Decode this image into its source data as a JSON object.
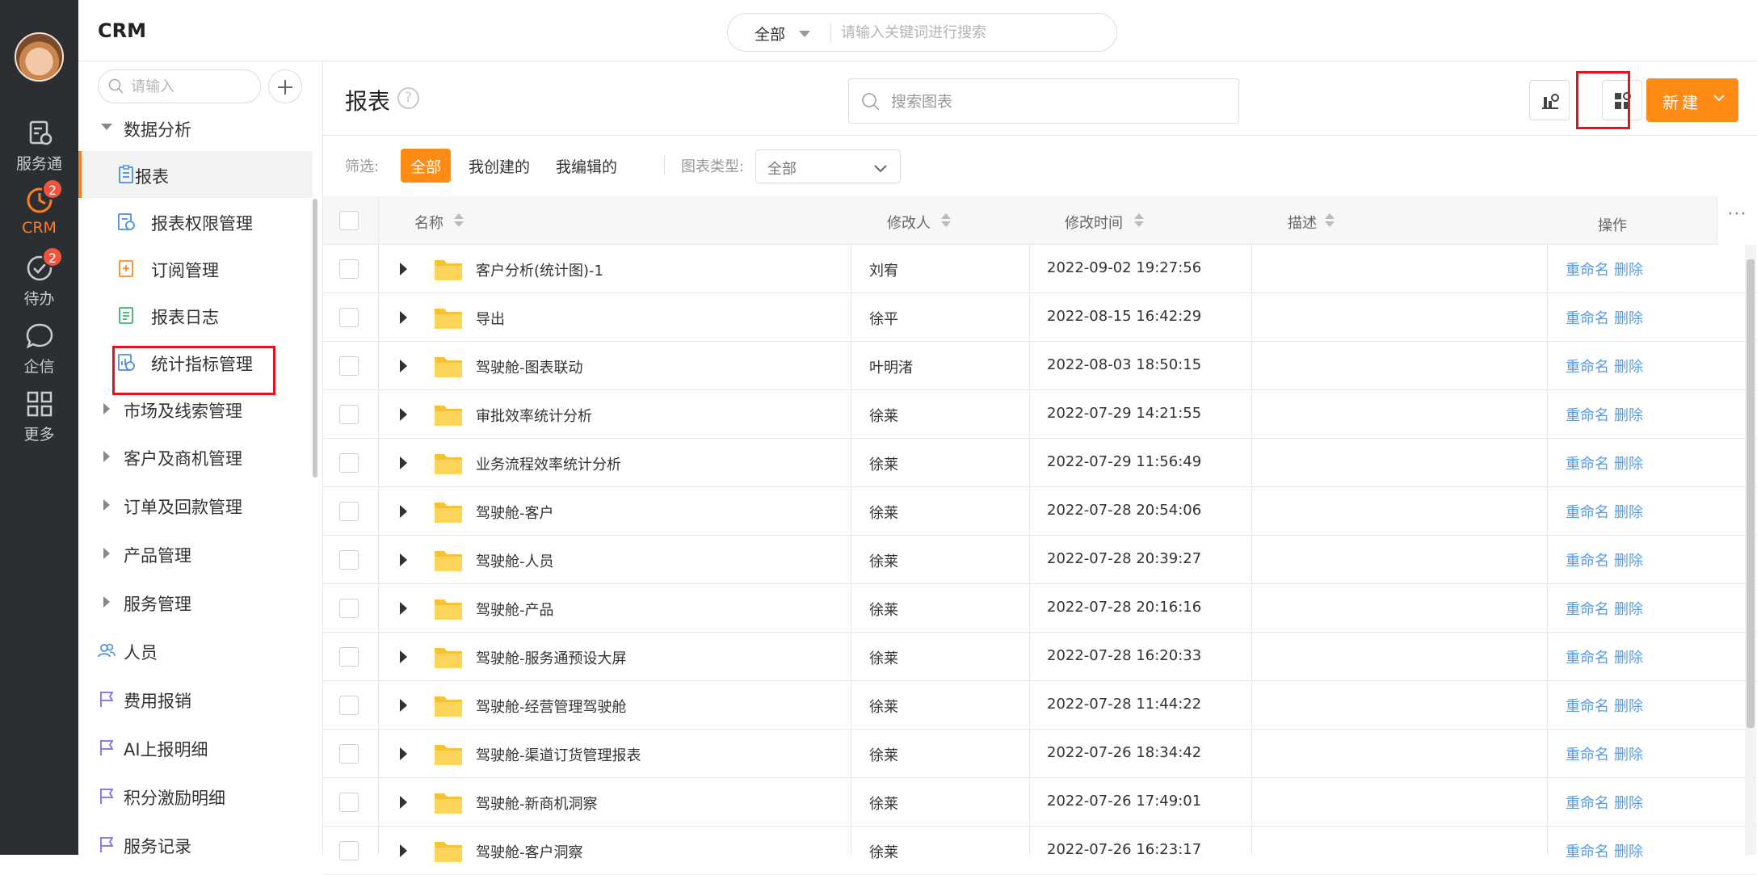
{
  "rail": {
    "items": [
      {
        "label": "服务通",
        "icon": "service-icon",
        "badge": ""
      },
      {
        "label": "CRM",
        "icon": "crm-clock-icon",
        "badge": "2",
        "active": true
      },
      {
        "label": "待办",
        "icon": "todo-check-icon",
        "badge": "2"
      },
      {
        "label": "企信",
        "icon": "chat-bubble-icon",
        "badge": ""
      },
      {
        "label": "更多",
        "icon": "grid-more-icon",
        "badge": ""
      }
    ]
  },
  "header": {
    "title": "CRM",
    "search": {
      "scope": "全部",
      "placeholder": "请输入关键词进行搜索"
    }
  },
  "sidebar": {
    "search_placeholder": "请输入",
    "group": "数据分析",
    "sub_items": [
      {
        "label": "报表",
        "icon": "report-icon"
      },
      {
        "label": "报表权限管理",
        "icon": "report-permission-icon"
      },
      {
        "label": "订阅管理",
        "icon": "subscription-icon"
      },
      {
        "label": "报表日志",
        "icon": "report-log-icon"
      },
      {
        "label": "统计指标管理",
        "icon": "metric-manage-icon"
      }
    ],
    "collapsed_groups": [
      "市场及线索管理",
      "客户及商机管理",
      "订单及回款管理",
      "产品管理",
      "服务管理"
    ],
    "links": [
      {
        "label": "人员",
        "icon": "people-icon"
      },
      {
        "label": "费用报销",
        "icon": "flag-icon"
      },
      {
        "label": "AI上报明细",
        "icon": "flag-icon"
      },
      {
        "label": "积分激励明细",
        "icon": "flag-icon"
      },
      {
        "label": "服务记录",
        "icon": "flag-icon"
      }
    ]
  },
  "main": {
    "title": "报表",
    "help": "?",
    "search_placeholder": "搜索图表",
    "new_button": "新建",
    "filter": {
      "label": "筛选:",
      "chips": [
        "全部",
        "我创建的",
        "我编辑的"
      ],
      "type_label": "图表类型:",
      "type_value": "全部"
    },
    "table": {
      "columns": {
        "name": "名称",
        "editor": "修改人",
        "mtime": "修改时间",
        "desc": "描述",
        "ops": "操作"
      },
      "more": "···",
      "actions": {
        "rename": "重命名",
        "delete": "删除"
      },
      "rows": [
        {
          "name": "客户分析(统计图)-1",
          "editor": "刘宥",
          "mtime": "2022-09-02 19:27:56"
        },
        {
          "name": "导出",
          "editor": "徐平",
          "mtime": "2022-08-15 16:42:29"
        },
        {
          "name": "驾驶舱-图表联动",
          "editor": "叶明渚",
          "mtime": "2022-08-03 18:50:15"
        },
        {
          "name": "审批效率统计分析",
          "editor": "徐莱",
          "mtime": "2022-07-29 14:21:55"
        },
        {
          "name": "业务流程效率统计分析",
          "editor": "徐莱",
          "mtime": "2022-07-29 11:56:49"
        },
        {
          "name": "驾驶舱-客户",
          "editor": "徐莱",
          "mtime": "2022-07-28 20:54:06"
        },
        {
          "name": "驾驶舱-人员",
          "editor": "徐莱",
          "mtime": "2022-07-28 20:39:27"
        },
        {
          "name": "驾驶舱-产品",
          "editor": "徐莱",
          "mtime": "2022-07-28 20:16:16"
        },
        {
          "name": "驾驶舱-服务通预设大屏",
          "editor": "徐莱",
          "mtime": "2022-07-28 16:20:33"
        },
        {
          "name": "驾驶舱-经营管理驾驶舱",
          "editor": "徐莱",
          "mtime": "2022-07-28 11:44:22"
        },
        {
          "name": "驾驶舱-渠道订货管理报表",
          "editor": "徐莱",
          "mtime": "2022-07-26 18:34:42"
        },
        {
          "name": "驾驶舱-新商机洞察",
          "editor": "徐莱",
          "mtime": "2022-07-26 17:49:01"
        },
        {
          "name": "驾驶舱-客户洞察",
          "editor": "徐莱",
          "mtime": "2022-07-26 16:23:17"
        }
      ]
    }
  },
  "colors": {
    "accent": "#ff8a14",
    "rail_bg": "#2b2e33",
    "link": "#5b9be0",
    "badge": "#f5533d",
    "highlight": "#e5111c"
  }
}
